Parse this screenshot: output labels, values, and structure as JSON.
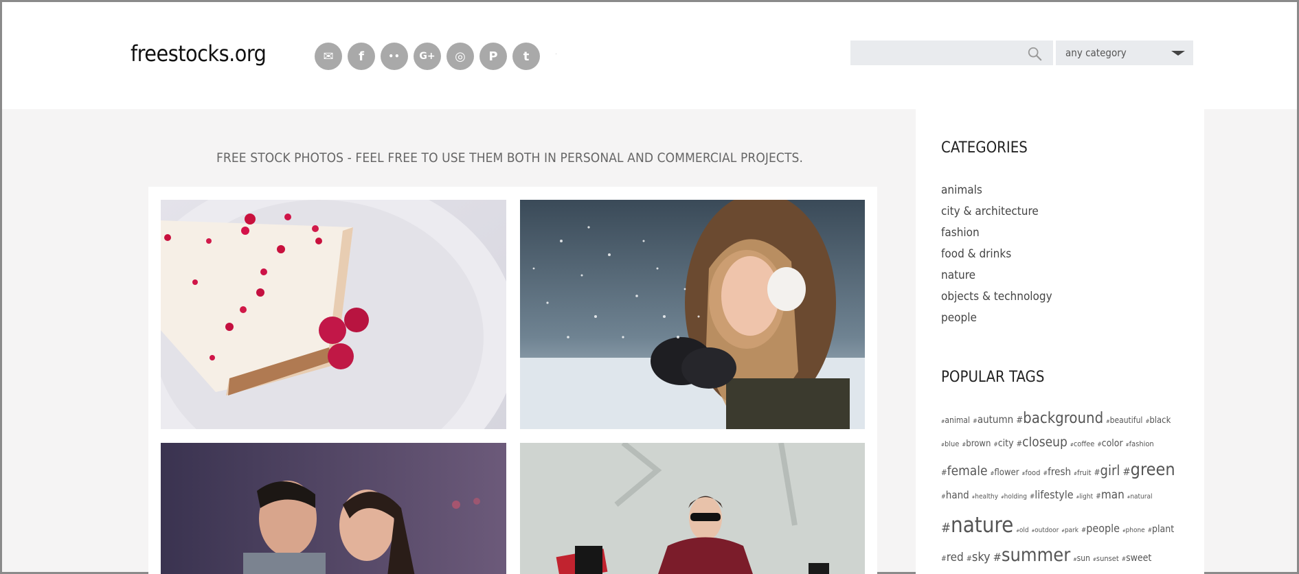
{
  "header": {
    "logo": "freestocks.org",
    "social": [
      {
        "icon": "mail-icon",
        "glyph": "✉"
      },
      {
        "icon": "facebook-icon",
        "glyph": "f"
      },
      {
        "icon": "flickr-icon",
        "glyph": "••"
      },
      {
        "icon": "google-plus-icon",
        "glyph": "G+"
      },
      {
        "icon": "instagram-icon",
        "glyph": "◎"
      },
      {
        "icon": "pinterest-icon",
        "glyph": "P"
      },
      {
        "icon": "tumblr-icon",
        "glyph": "t"
      },
      {
        "icon": "twitter-icon",
        "glyph": "🐦"
      }
    ],
    "search": {
      "placeholder": "",
      "value": ""
    },
    "category_select": {
      "selected": "any category"
    }
  },
  "main": {
    "tagline": "FREE STOCK PHOTOS - FEEL FREE TO USE THEM BOTH IN PERSONAL AND COMMERCIAL PROJECTS."
  },
  "sidebar": {
    "categories_title": "CATEGORIES",
    "categories": [
      "animals",
      "city & architecture",
      "fashion",
      "food & drinks",
      "nature",
      "objects & technology",
      "people"
    ],
    "tags_title": "POPULAR TAGS",
    "tag_lines": [
      [
        {
          "t": "animal",
          "s": 12
        },
        {
          "t": "autumn",
          "s": 15
        },
        {
          "t": "background",
          "s": 22
        },
        {
          "t": "beautiful",
          "s": 12
        },
        {
          "t": "black",
          "s": 13
        }
      ],
      [
        {
          "t": "blue",
          "s": 11
        },
        {
          "t": "brown",
          "s": 13
        },
        {
          "t": "city",
          "s": 14
        },
        {
          "t": "closeup",
          "s": 19
        },
        {
          "t": "coffee",
          "s": 11
        },
        {
          "t": "color",
          "s": 14
        },
        {
          "t": "fashion",
          "s": 11
        }
      ],
      [
        {
          "t": "female",
          "s": 19
        },
        {
          "t": "flower",
          "s": 13
        },
        {
          "t": "food",
          "s": 11
        },
        {
          "t": "fresh",
          "s": 15
        },
        {
          "t": "fruit",
          "s": 11
        },
        {
          "t": "girl",
          "s": 20
        },
        {
          "t": "green",
          "s": 25
        }
      ],
      [
        {
          "t": "hand",
          "s": 15
        },
        {
          "t": "healthy",
          "s": 10
        },
        {
          "t": "holding",
          "s": 10
        },
        {
          "t": "lifestyle",
          "s": 16
        },
        {
          "t": "light",
          "s": 10
        },
        {
          "t": "man",
          "s": 17
        },
        {
          "t": "natural",
          "s": 10
        }
      ],
      [
        {
          "t": "nature",
          "s": 31
        },
        {
          "t": "old",
          "s": 10
        },
        {
          "t": "outdoor",
          "s": 10
        },
        {
          "t": "park",
          "s": 10
        },
        {
          "t": "people",
          "s": 16
        },
        {
          "t": "phone",
          "s": 10
        },
        {
          "t": "plant",
          "s": 14
        }
      ],
      [
        {
          "t": "red",
          "s": 17
        },
        {
          "t": "sky",
          "s": 18
        },
        {
          "t": "summer",
          "s": 27
        },
        {
          "t": "sun",
          "s": 12
        },
        {
          "t": "sunset",
          "s": 11
        },
        {
          "t": "sweet",
          "s": 14
        }
      ]
    ]
  }
}
